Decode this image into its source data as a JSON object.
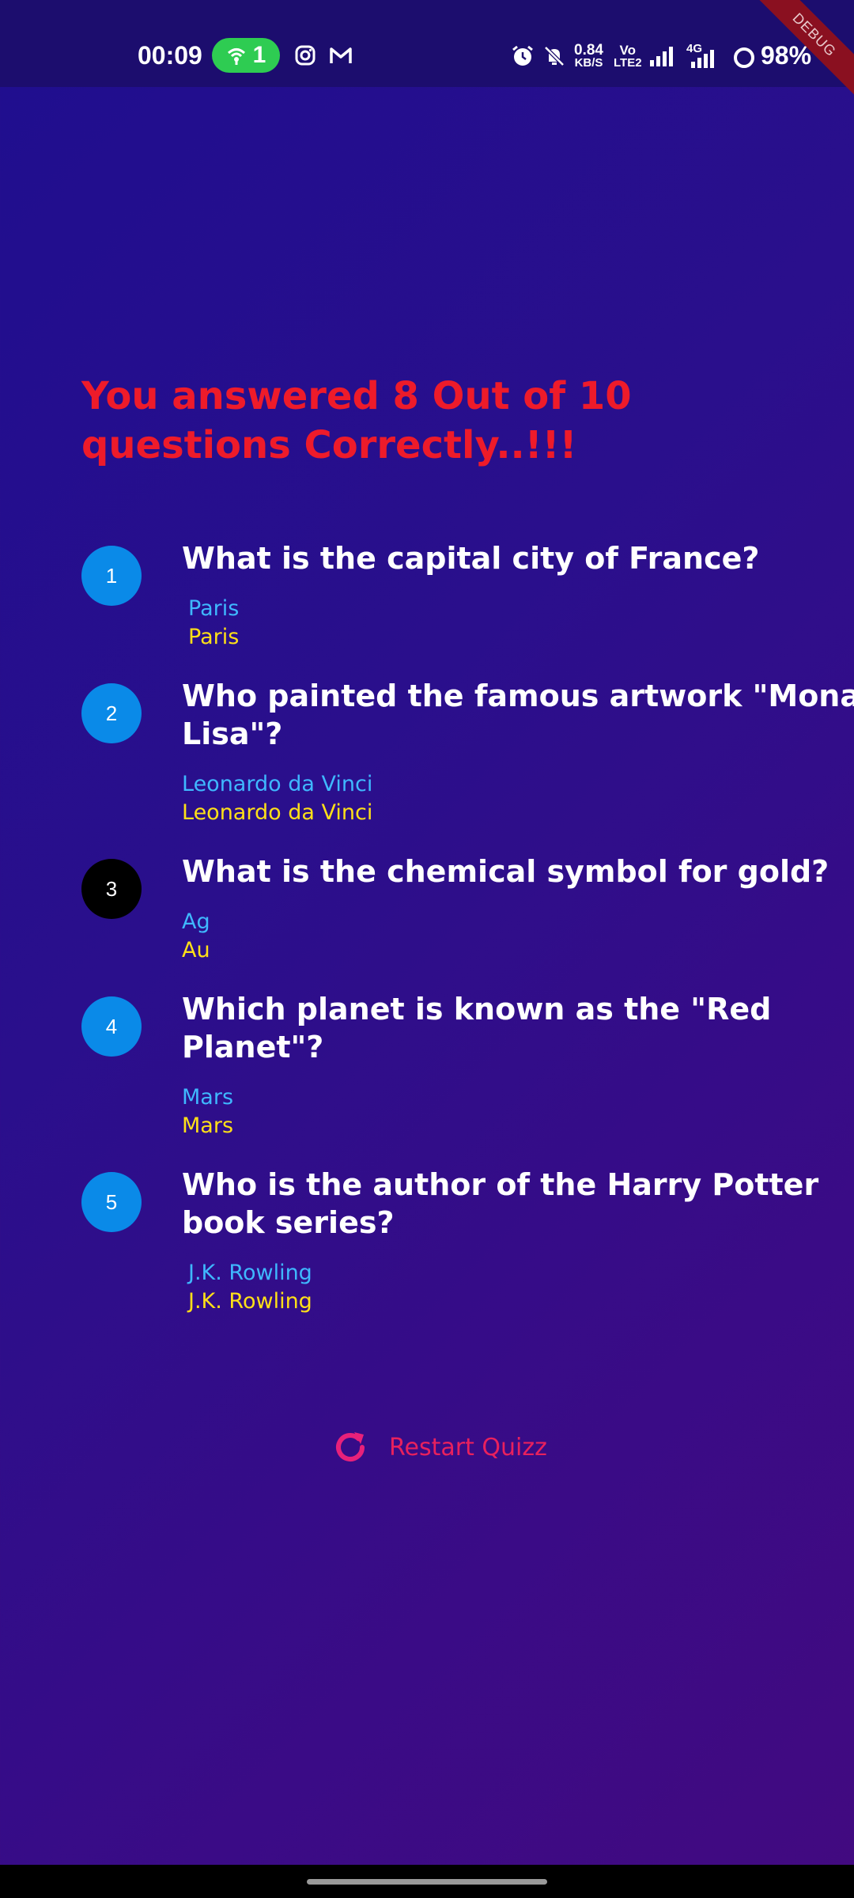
{
  "status_bar": {
    "time": "00:09",
    "hotspot_count": "1",
    "speed_value": "0.84",
    "speed_unit": "KB/S",
    "volte_top": "Vo",
    "volte_bottom": "LTE2",
    "network_type": "4G",
    "battery": "98%",
    "icons": [
      "wifi-hotspot-icon",
      "instagram-icon",
      "gmail-icon",
      "alarm-icon",
      "mute-icon",
      "signal-icon",
      "battery-icon"
    ]
  },
  "debug_banner": "DEBUG",
  "result": {
    "title": "You answered 8 Out of 10 questions Correctly..!!!"
  },
  "questions": [
    {
      "number": "1",
      "question": "What is the capital city of France?",
      "user_answer": "Paris",
      "correct_answer": "Paris",
      "is_correct": true
    },
    {
      "number": "2",
      "question": "Who painted the famous artwork \"Mona Lisa\"?",
      "user_answer": "Leonardo da Vinci",
      "correct_answer": "Leonardo da Vinci",
      "is_correct": true
    },
    {
      "number": "3",
      "question": "What is the chemical symbol for gold?",
      "user_answer": "Ag",
      "correct_answer": "Au",
      "is_correct": false
    },
    {
      "number": "4",
      "question": "Which planet is known as the \"Red Planet\"?",
      "user_answer": "Mars",
      "correct_answer": "Mars",
      "is_correct": true
    },
    {
      "number": "5",
      "question": "Who is the author of the Harry Potter book series?",
      "user_answer": "J.K. Rowling",
      "correct_answer": "J.K. Rowling",
      "is_correct": true
    }
  ],
  "restart": {
    "label": "Restart Quizz",
    "icon": "restart-icon"
  },
  "colors": {
    "correct_circle": "#0a8ae8",
    "wrong_circle": "#000000",
    "user_answer": "#3fb8ff",
    "correct_answer": "#ffe018",
    "title": "#ee1b2a",
    "restart": "#e8215d"
  }
}
